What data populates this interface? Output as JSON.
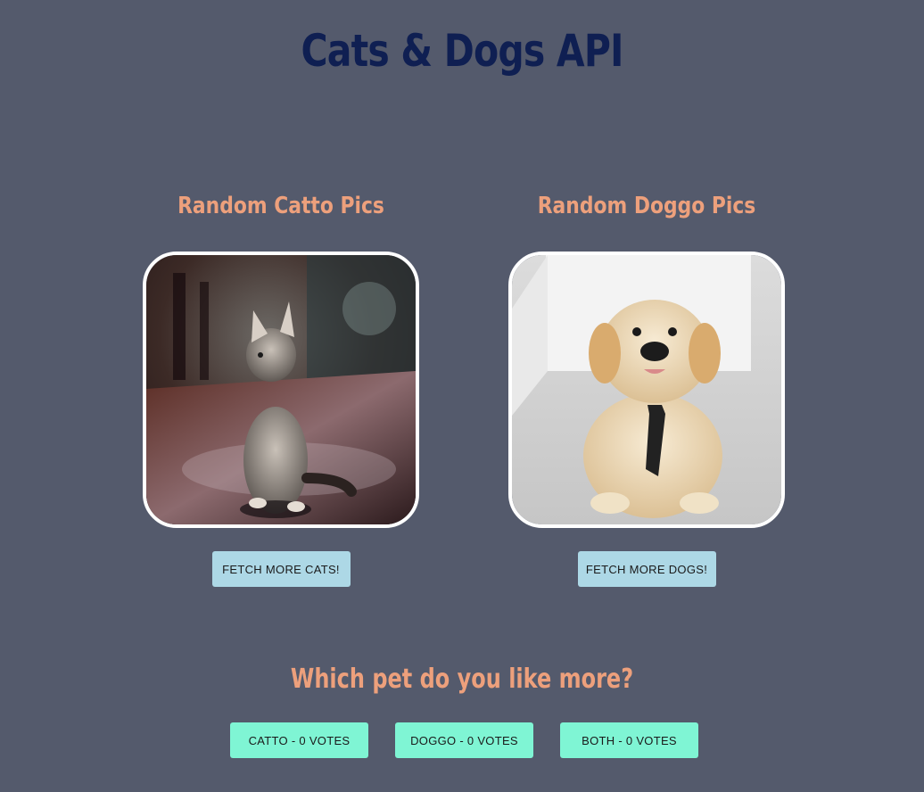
{
  "header": {
    "title": "Cats & Dogs API"
  },
  "cats": {
    "heading": "Random Catto Pics",
    "image_alt": "kitten photo",
    "fetch_label": "FETCH MORE CATS!"
  },
  "dogs": {
    "heading": "Random Doggo Pics",
    "image_alt": "puppy photo",
    "fetch_label": "FETCH MORE DOGS!"
  },
  "vote": {
    "question": "Which pet do you like more?",
    "options": [
      {
        "label": "CATTO - 0 VOTES"
      },
      {
        "label": "DOGGO - 0 VOTES"
      },
      {
        "label": "BOTH - 0 VOTES"
      }
    ]
  },
  "colors": {
    "background": "#545a6c",
    "title": "#0f1f52",
    "heading_accent": "#eda07c",
    "fetch_button": "#add8e6",
    "vote_button": "#7ff5d4",
    "photo_border": "#ffffff"
  },
  "icons": {
    "cat_photo": "kitten-photo",
    "dog_photo": "puppy-photo"
  }
}
